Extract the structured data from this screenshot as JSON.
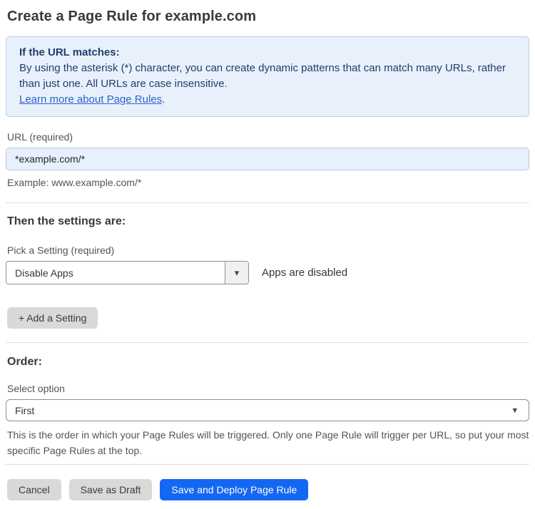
{
  "page": {
    "title": "Create a Page Rule for example.com"
  },
  "info_box": {
    "heading": "If the URL matches:",
    "body": "By using the asterisk (*) character, you can create dynamic patterns that can match many URLs, rather than just one. All URLs are case insensitive.",
    "link_label": "Learn more about Page Rules",
    "link_suffix": "."
  },
  "url_field": {
    "label": "URL (required)",
    "value": "*example.com/*",
    "helper": "Example: www.example.com/*"
  },
  "settings_section": {
    "heading": "Then the settings are:",
    "setting_label": "Pick a Setting (required)",
    "setting_value": "Disable Apps",
    "setting_status": "Apps are disabled",
    "add_setting_label": "+ Add a Setting"
  },
  "order_section": {
    "heading": "Order:",
    "select_label": "Select option",
    "select_value": "First",
    "helper": "This is the order in which your Page Rules will be triggered. Only one Page Rule will trigger per URL, so put your most specific Page Rules at the top."
  },
  "footer": {
    "cancel_label": "Cancel",
    "save_draft_label": "Save as Draft",
    "save_deploy_label": "Save and Deploy Page Rule"
  },
  "icons": {
    "dropdown_caret": "▾"
  },
  "colors": {
    "accent_blue": "#1467f2",
    "info_bg": "#e8f1fb",
    "info_border": "#b9d0ea",
    "info_text": "#1f3d70",
    "link_blue": "#2c62c9",
    "input_bg": "#e7f0fc"
  }
}
